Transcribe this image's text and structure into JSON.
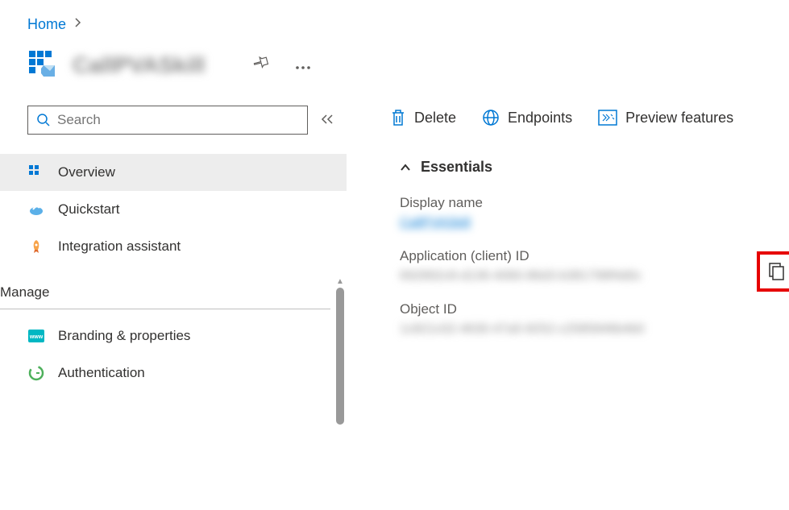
{
  "breadcrumb": {
    "home": "Home"
  },
  "header": {
    "title": "CallPVASkill"
  },
  "sidebar": {
    "search_placeholder": "Search",
    "items": [
      {
        "label": "Overview"
      },
      {
        "label": "Quickstart"
      },
      {
        "label": "Integration assistant"
      }
    ],
    "manage_header": "Manage",
    "manage_items": [
      {
        "label": "Branding & properties"
      },
      {
        "label": "Authentication"
      }
    ]
  },
  "toolbar": {
    "delete": "Delete",
    "endpoints": "Endpoints",
    "preview_features": "Preview features"
  },
  "essentials": {
    "title": "Essentials",
    "display_name_label": "Display name",
    "display_name_value": "CallPVASkill",
    "app_id_label": "Application (client) ID",
    "app_id_value": "692892c8-d136-4060-86d3-b381798f4d0c",
    "object_id_label": "Object ID",
    "object_id_value": "1c821c02-4630-47a5-8252-c2585846b4b0"
  }
}
